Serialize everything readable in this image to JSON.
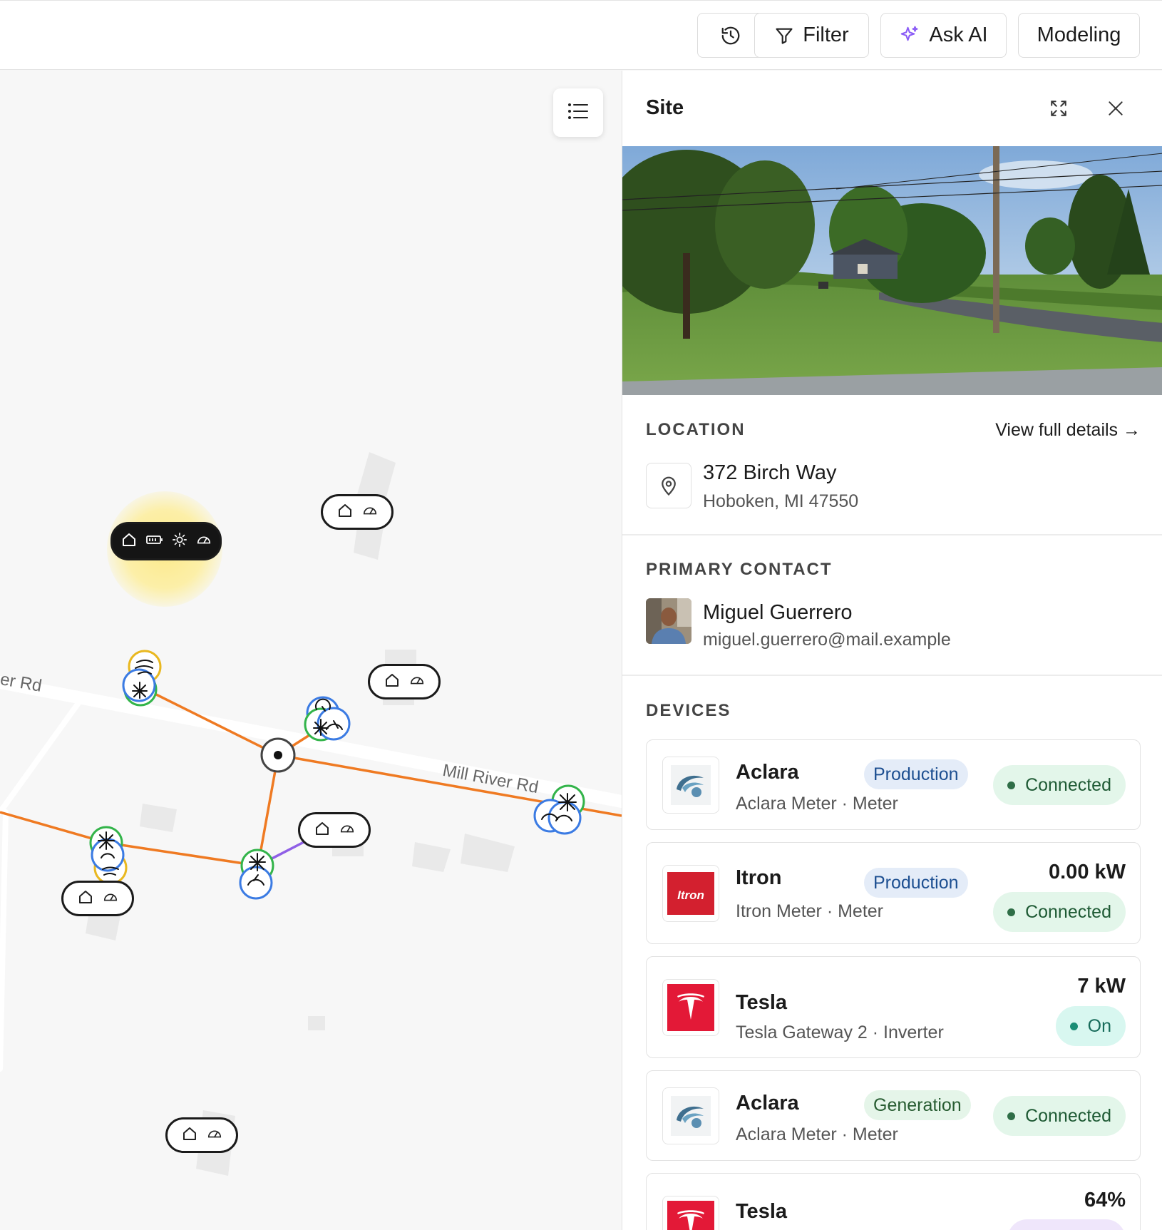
{
  "toolbar": {
    "history_label": "",
    "filter_label": "Filter",
    "ask_ai_label": "Ask AI",
    "modeling_label": "Modeling"
  },
  "map": {
    "road_labels": [
      "er Rd",
      "Mill River Rd"
    ]
  },
  "panel": {
    "title": "Site",
    "location": {
      "label": "LOCATION",
      "view_link": "View full details →",
      "street": "372 Birch Way",
      "city_line": "Hoboken, MI 47550"
    },
    "contact": {
      "label": "PRIMARY CONTACT",
      "name": "Miguel Guerrero",
      "email": "miguel.guerrero@mail.example"
    },
    "devices": {
      "label": "DEVICES",
      "items": [
        {
          "brand": "Aclara",
          "tag": "Production",
          "subtitle": "Aclara Meter · Meter",
          "metric": "",
          "status": "Connected"
        },
        {
          "brand": "Itron",
          "tag": "Production",
          "subtitle": "Itron Meter · Meter",
          "metric": "0.00 kW",
          "status": "Connected",
          "logo_text": "Itron"
        },
        {
          "brand": "Tesla",
          "tag": "",
          "subtitle": "Tesla Gateway 2 · Inverter",
          "metric": "7 kW",
          "status": "On"
        },
        {
          "brand": "Aclara",
          "tag": "Generation",
          "subtitle": "Aclara Meter · Meter",
          "metric": "",
          "status": "Connected"
        },
        {
          "brand": "Tesla",
          "tag": "",
          "subtitle": "",
          "metric": "64%",
          "status": ""
        }
      ]
    }
  },
  "colors": {
    "feeder_line": "#ef7a22",
    "secondary_line": "#8f5fe6",
    "ring_green": "#33b44a",
    "ring_blue": "#3b7be3",
    "ring_yellow": "#e9b820",
    "ask_ai_accent": "#8b5cf6",
    "tesla_red": "#e31937",
    "itron_red": "#d3202f"
  }
}
